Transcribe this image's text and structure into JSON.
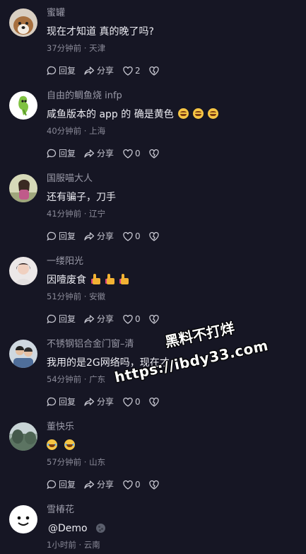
{
  "comments": [
    {
      "username": "蜜罐",
      "content": "现在才知道 真的晚了吗?",
      "emojis": [],
      "meta": "37分钟前 · 天津",
      "reply": "回复",
      "share": "分享",
      "likes": "2"
    },
    {
      "username": "自由的鲷鱼烧 infp",
      "content": "咸鱼版本的 app 的 确是黄色",
      "emojis": [
        "grin",
        "grin",
        "grin"
      ],
      "meta": "40分钟前 · 上海",
      "reply": "回复",
      "share": "分享",
      "likes": "0"
    },
    {
      "username": "国服喵大人",
      "content": "还有骗子，刀手",
      "emojis": [],
      "meta": "41分钟前 · 辽宁",
      "reply": "回复",
      "share": "分享",
      "likes": "0"
    },
    {
      "username": "一缕阳光",
      "content": "因噎废食",
      "emojis": [
        "thumbs-up",
        "thumbs-up",
        "thumbs-up"
      ],
      "meta": "51分钟前 · 安徽",
      "reply": "回复",
      "share": "分享",
      "likes": "0"
    },
    {
      "username": "不锈钢铝合金门窗–清",
      "content": "我用的是2G网络吗，现在才",
      "emojis": [],
      "meta": "54分钟前 · 广东",
      "reply": "回复",
      "share": "分享",
      "likes": "0"
    },
    {
      "username": "董快乐",
      "content": "",
      "emojis": [
        "laugh",
        "laugh"
      ],
      "meta": "57分钟前 · 山东",
      "reply": "回复",
      "share": "分享",
      "likes": "0"
    },
    {
      "username": "雪椿花",
      "content": "@Demo",
      "emojis": [
        "moon"
      ],
      "meta": "1小时前 · 云南",
      "reply": "",
      "share": "",
      "likes": ""
    }
  ],
  "watermark": {
    "line1": "黑料不打烊",
    "line2": "https://ibdy33.com"
  },
  "icons": {
    "reply": "comment-bubble-icon",
    "share": "share-arrow-icon",
    "like": "heart-icon",
    "dislike": "broken-heart-icon"
  },
  "colors": {
    "background": "#161624",
    "text": "#ececf2",
    "muted": "#8a8a98"
  }
}
